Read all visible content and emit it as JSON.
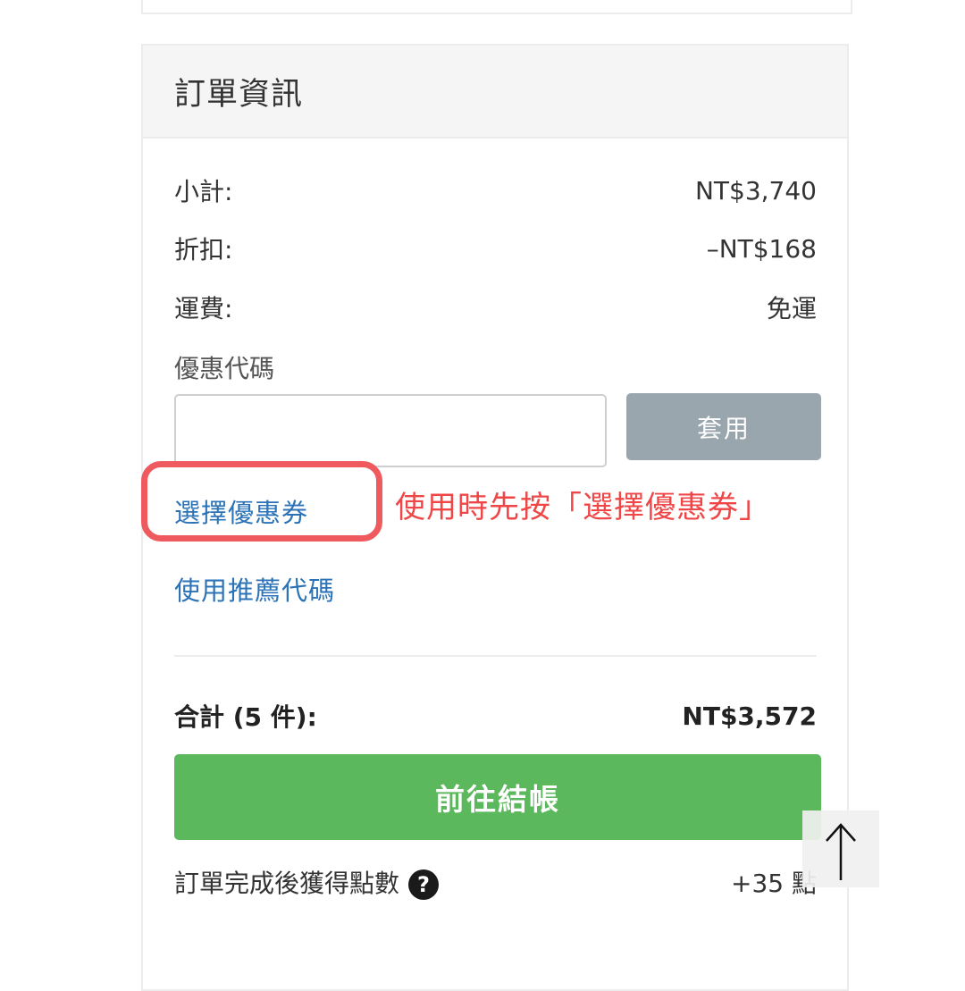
{
  "order_info": {
    "title": "訂單資訊",
    "subtotal": {
      "label": "小計:",
      "value": "NT$3,740"
    },
    "discount": {
      "label": "折扣:",
      "value": "–NT$168"
    },
    "shipping": {
      "label": "運費:",
      "value": "免運"
    },
    "promo": {
      "label": "優惠代碼",
      "input_value": "",
      "apply_label": "套用"
    },
    "select_coupon_label": "選擇優惠券",
    "referral_label": "使用推薦代碼",
    "total": {
      "label": "合計 (5 件):",
      "value": "NT$3,572"
    },
    "checkout_label": "前往結帳",
    "points": {
      "label": "訂單完成後獲得點數",
      "value": "+35 點",
      "help_icon": "?"
    }
  },
  "annotation": {
    "text": "使用時先按「選擇優惠券」",
    "color": "#ef4747"
  },
  "colors": {
    "link": "#2b73b6",
    "checkout": "#5cb85c",
    "apply_button": "#9aa6ae",
    "highlight": "#ef5a5f"
  },
  "icons": {
    "help": "question-circle-icon",
    "scroll_top": "arrow-up-icon"
  }
}
